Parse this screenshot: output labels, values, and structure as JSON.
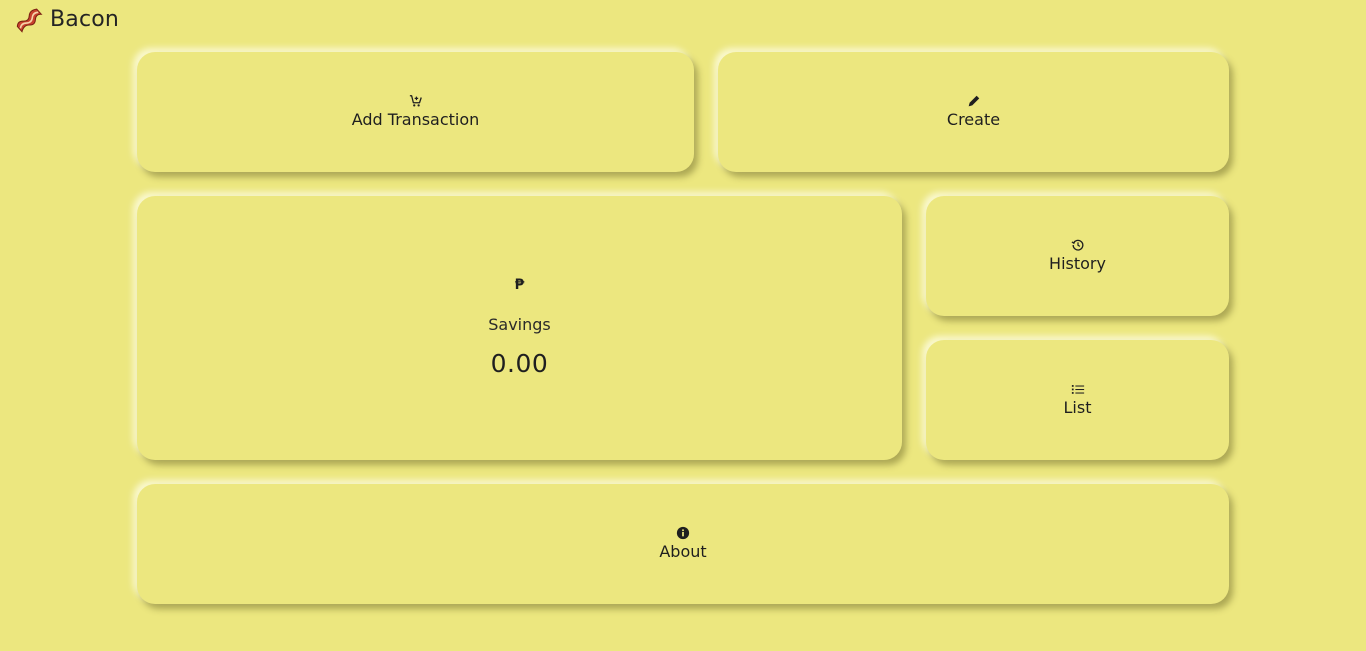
{
  "app": {
    "title": "Bacon",
    "logo_icon": "bacon-icon",
    "background_color": "#ece77f"
  },
  "cards": {
    "add_transaction": {
      "label": "Add Transaction",
      "icon": "cart-plus-icon"
    },
    "create": {
      "label": "Create",
      "icon": "pencil-icon"
    },
    "history": {
      "label": "History",
      "icon": "history-icon"
    },
    "list": {
      "label": "List",
      "icon": "list-icon"
    },
    "about": {
      "label": "About",
      "icon": "info-icon"
    }
  },
  "savings": {
    "currency_symbol": "₱",
    "label": "Savings",
    "value": "0.00"
  }
}
